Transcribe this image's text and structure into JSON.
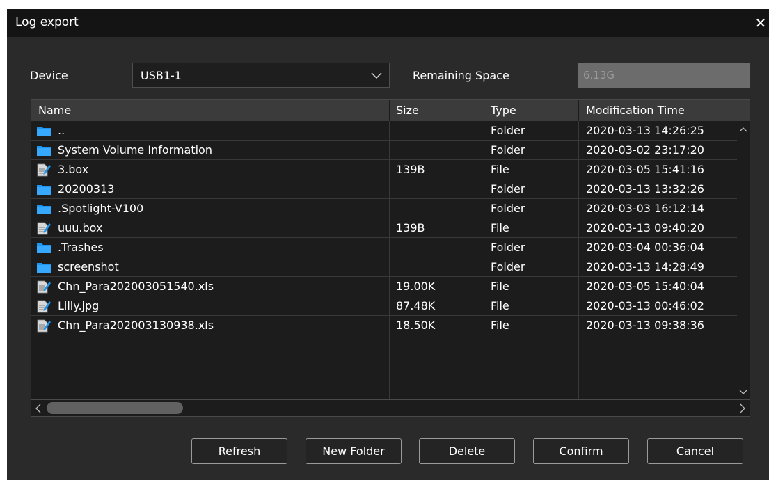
{
  "dialog": {
    "title": "Log export",
    "close_label": "✕"
  },
  "device": {
    "label": "Device",
    "value": "USB1-1"
  },
  "space": {
    "label": "Remaining Space",
    "value": "6.13G"
  },
  "table": {
    "columns": [
      "Name",
      "Size",
      "Type",
      "Modification Time"
    ],
    "rows": [
      {
        "name": "..",
        "size": "",
        "type": "Folder",
        "time": "2020-03-13 14:26:25",
        "icon": "folder-icon"
      },
      {
        "name": "System Volume Information",
        "size": "",
        "type": "Folder",
        "time": "2020-03-02 23:17:20",
        "icon": "folder-icon"
      },
      {
        "name": "3.box",
        "size": "139B",
        "type": "File",
        "time": "2020-03-05 15:41:16",
        "icon": "file-icon"
      },
      {
        "name": "20200313",
        "size": "",
        "type": "Folder",
        "time": "2020-03-13 13:32:26",
        "icon": "folder-icon"
      },
      {
        "name": ".Spotlight-V100",
        "size": "",
        "type": "Folder",
        "time": "2020-03-03 16:12:14",
        "icon": "folder-icon"
      },
      {
        "name": "uuu.box",
        "size": "139B",
        "type": "File",
        "time": "2020-03-13 09:40:20",
        "icon": "file-icon"
      },
      {
        "name": ".Trashes",
        "size": "",
        "type": "Folder",
        "time": "2020-03-04 00:36:04",
        "icon": "folder-icon"
      },
      {
        "name": "screenshot",
        "size": "",
        "type": "Folder",
        "time": "2020-03-13 14:28:49",
        "icon": "folder-icon"
      },
      {
        "name": "Chn_Para202003051540.xls",
        "size": "19.00K",
        "type": "File",
        "time": "2020-03-05 15:40:04",
        "icon": "file-icon"
      },
      {
        "name": "Lilly.jpg",
        "size": "87.48K",
        "type": "File",
        "time": "2020-03-13 00:46:02",
        "icon": "file-icon"
      },
      {
        "name": "Chn_Para202003130938.xls",
        "size": "18.50K",
        "type": "File",
        "time": "2020-03-13 09:38:36",
        "icon": "file-icon"
      }
    ]
  },
  "buttons": {
    "refresh": "Refresh",
    "new_folder": "New Folder",
    "delete": "Delete",
    "confirm": "Confirm",
    "cancel": "Cancel"
  },
  "colors": {
    "background": "#2a2a2a",
    "titlebar": "#141414",
    "folder": "#1e96f0",
    "table": "#1c1c1c"
  }
}
